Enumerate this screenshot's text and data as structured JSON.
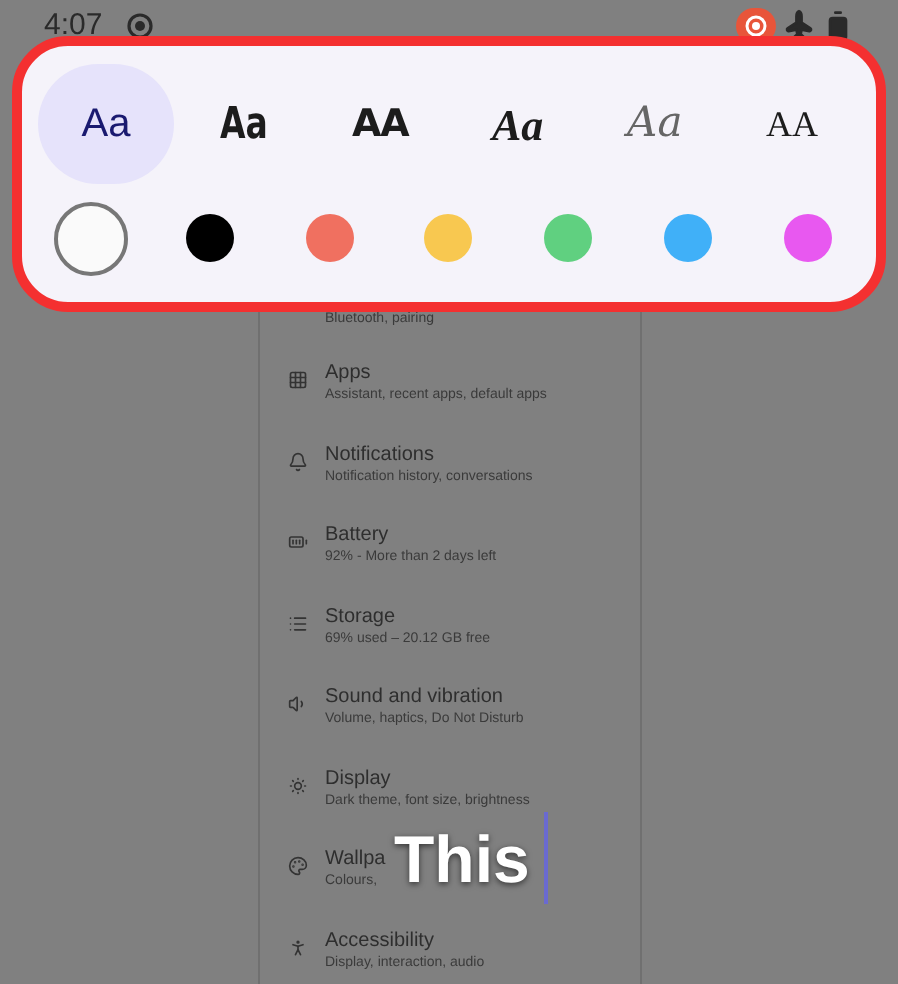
{
  "status_bar": {
    "time": "4:07"
  },
  "font_styles": [
    {
      "label": "Aa",
      "kind": "sans",
      "selected": true
    },
    {
      "label": "Aa",
      "kind": "condensed",
      "selected": false
    },
    {
      "label": "AA",
      "kind": "heavy",
      "selected": false
    },
    {
      "label": "Aa",
      "kind": "script",
      "selected": false
    },
    {
      "label": "Aa",
      "kind": "thin-script",
      "selected": false
    },
    {
      "label": "AA",
      "kind": "serif",
      "selected": false
    }
  ],
  "colors": [
    {
      "color": "#fafafa",
      "selected": true
    },
    {
      "color": "#000000",
      "selected": false
    },
    {
      "color": "#f07060",
      "selected": false
    },
    {
      "color": "#f8c850",
      "selected": false
    },
    {
      "color": "#60d080",
      "selected": false
    },
    {
      "color": "#40b0f8",
      "selected": false
    },
    {
      "color": "#e858f0",
      "selected": false
    }
  ],
  "settings": [
    {
      "kind": "none",
      "subtitle": "Bluetooth, pairing"
    },
    {
      "kind": "apps",
      "title": "Apps",
      "subtitle": "Assistant, recent apps, default apps"
    },
    {
      "kind": "bell",
      "title": "Notifications",
      "subtitle": "Notification history, conversations"
    },
    {
      "kind": "battery",
      "title": "Battery",
      "subtitle": "92% - More than 2 days left"
    },
    {
      "kind": "storage",
      "title": "Storage",
      "subtitle": "69% used – 20.12 GB free"
    },
    {
      "kind": "sound",
      "title": "Sound and vibration",
      "subtitle": "Volume, haptics, Do Not Disturb"
    },
    {
      "kind": "display",
      "title": "Display",
      "subtitle": "Dark theme, font size, brightness"
    },
    {
      "kind": "palette",
      "title": "Wallpa",
      "subtitle": "Colours,"
    },
    {
      "kind": "accessibility",
      "title": "Accessibility",
      "subtitle": "Display, interaction, audio"
    }
  ],
  "overlay_text": "This"
}
